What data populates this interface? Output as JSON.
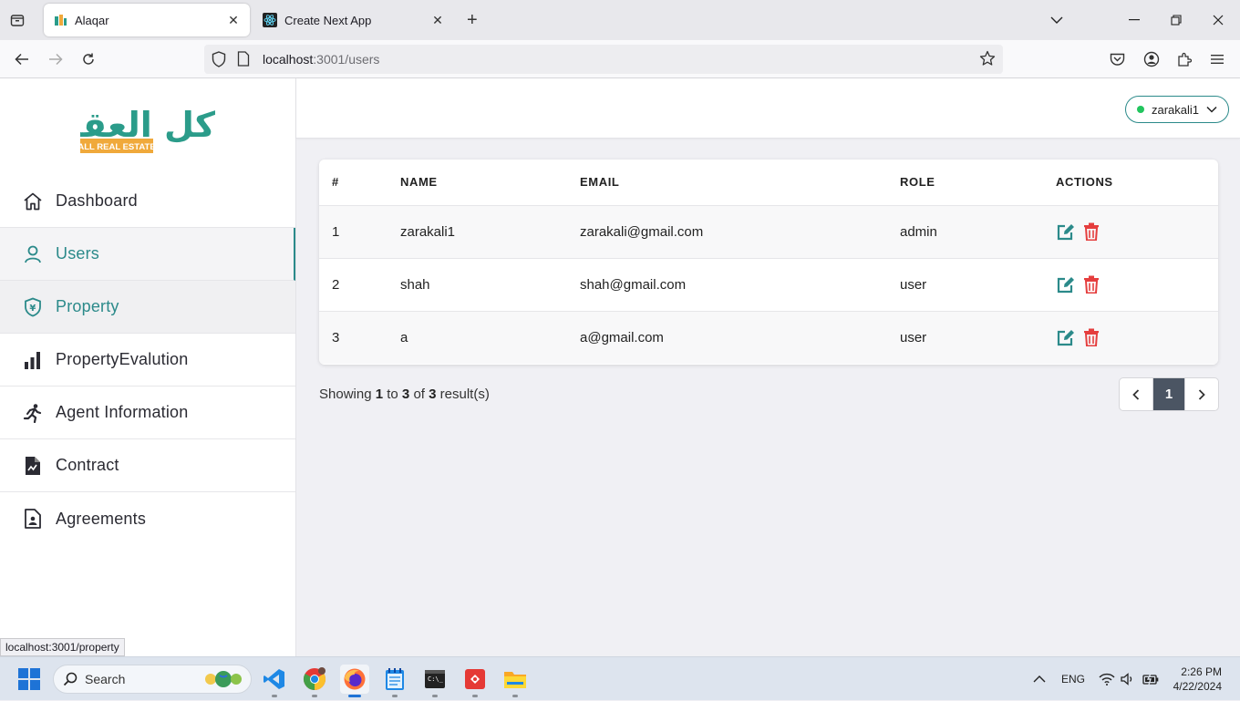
{
  "browser": {
    "tabs": [
      {
        "title": "Alaqar",
        "active": true
      },
      {
        "title": "Create Next App",
        "active": false
      }
    ],
    "url_host": "localhost",
    "url_rest": ":3001/users",
    "status_url": "localhost:3001/property"
  },
  "logo": {
    "arabic_text": "كل العقار",
    "tagline": "ALL REAL ESTATE"
  },
  "sidebar": {
    "items": [
      {
        "label": "Dashboard",
        "icon": "home-icon"
      },
      {
        "label": "Users",
        "icon": "user-icon",
        "state": "active"
      },
      {
        "label": "Property",
        "icon": "shield-yen-icon",
        "state": "hover"
      },
      {
        "label": "PropertyEvalution",
        "icon": "bar-chart-icon"
      },
      {
        "label": "Agent Information",
        "icon": "running-person-icon"
      },
      {
        "label": "Contract",
        "icon": "file-chart-icon"
      },
      {
        "label": "Agreements",
        "icon": "file-person-icon"
      }
    ]
  },
  "header": {
    "username": "zarakali1",
    "status_color": "#22c55e"
  },
  "table": {
    "columns": [
      "#",
      "NAME",
      "EMAIL",
      "ROLE",
      "ACTIONS"
    ],
    "rows": [
      {
        "num": "1",
        "name": "zarakali1",
        "email": "zarakali@gmail.com",
        "role": "admin"
      },
      {
        "num": "2",
        "name": "shah",
        "email": "shah@gmail.com",
        "role": "user"
      },
      {
        "num": "3",
        "name": "a",
        "email": "a@gmail.com",
        "role": "user"
      }
    ]
  },
  "pagination": {
    "showing_prefix": "Showing",
    "from": "1",
    "to_word": "to",
    "to": "3",
    "of_word": "of",
    "total": "3",
    "suffix": "result(s)",
    "current_page": "1"
  },
  "taskbar": {
    "search_placeholder": "Search",
    "language": "ENG",
    "time": "2:26 PM",
    "date": "4/22/2024"
  },
  "colors": {
    "accent": "#2b8a8a",
    "edit": "#2b8a8a",
    "delete": "#e53e3e",
    "logo_green": "#2b9c8a",
    "logo_orange": "#f0a93b"
  }
}
